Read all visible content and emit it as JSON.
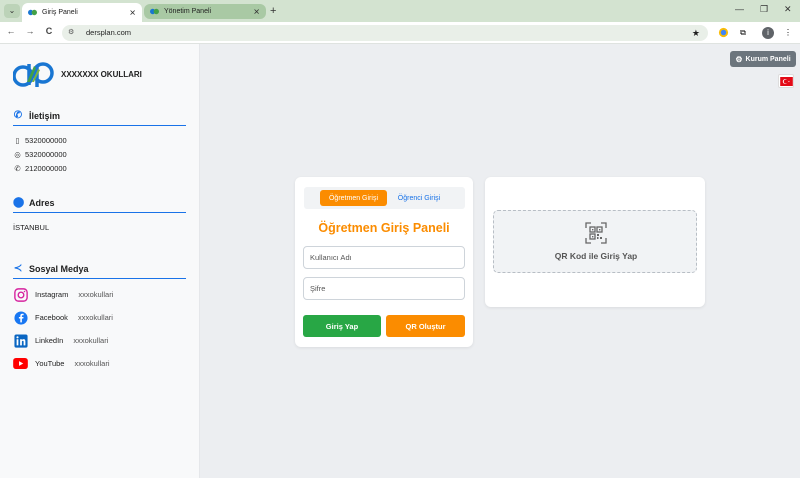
{
  "browser": {
    "tabs": [
      {
        "label": "Giriş Paneli",
        "close": "✕"
      },
      {
        "label": "Yönetim Paneli",
        "close": "✕"
      }
    ],
    "new_tab": "+",
    "window_controls": {
      "minimize": "—",
      "restore": "❐",
      "close": "✕"
    },
    "nav": {
      "back": "←",
      "forward": "→",
      "reload": "C"
    },
    "url": "dersplan.com",
    "star": "★",
    "profile_initial": "i",
    "menu": "⋮"
  },
  "sidebar": {
    "school_name": "XXXXXXX OKULLARI",
    "contact": {
      "title": "İletişim",
      "phone": "5320000000",
      "whatsapp": "5320000000",
      "landline": "2120000000"
    },
    "address": {
      "title": "Adres",
      "value": "İSTANBUL"
    },
    "social": {
      "title": "Sosyal Medya",
      "items": [
        {
          "name": "Instagram",
          "handle": "xxxokullari"
        },
        {
          "name": "Facebook",
          "handle": "xxxokullari"
        },
        {
          "name": "LinkedIn",
          "handle": "xxxokullari"
        },
        {
          "name": "YouTube",
          "handle": "xxxokullari"
        }
      ]
    }
  },
  "main": {
    "kurum_button": "Kurum Paneli",
    "login": {
      "tab_teacher": "Öğretmen Girişi",
      "tab_student": "Öğrenci Girişi",
      "title": "Öğretmen Giriş Paneli",
      "username_placeholder": "Kullanıcı Adı",
      "password_placeholder": "Şifre",
      "login_button": "Giriş Yap",
      "qr_button": "QR Oluştur"
    },
    "qr_login": {
      "label": "QR Kod ile Giriş Yap"
    }
  },
  "colors": {
    "accent_orange": "#fb8c00",
    "accent_blue": "#1a73e8",
    "success_green": "#28a745",
    "secondary_gray": "#6c757d"
  }
}
